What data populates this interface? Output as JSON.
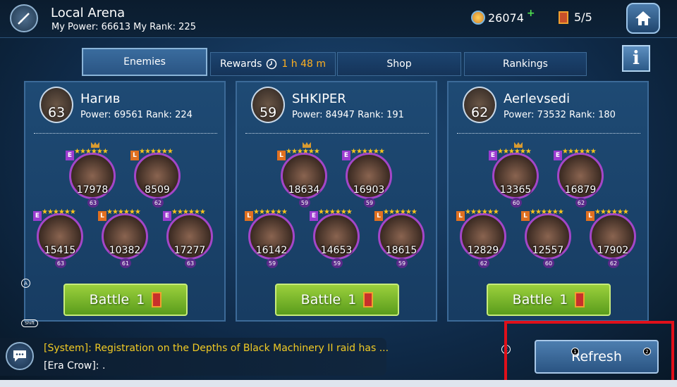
{
  "header": {
    "title": "Local Arena",
    "subtitle": "My Power: 66613 My Rank: 225",
    "coins": "26074",
    "coins_plus": "+",
    "tickets": "5/5"
  },
  "tabs": {
    "enemies": "Enemies",
    "rewards": "Rewards",
    "rewards_timer": "1 h 48 m",
    "shop": "Shop",
    "rankings": "Rankings",
    "info": "i"
  },
  "opponents": [
    {
      "name": "Нагив",
      "level": "63",
      "stats": "Power: 69561 Rank: 224",
      "battle_label": "Battle",
      "battle_cost": "1",
      "heroes": [
        {
          "power": "17978",
          "level": "63",
          "badge": "E"
        },
        {
          "power": "8509",
          "level": "62",
          "badge": "L"
        },
        {
          "power": "15415",
          "level": "63",
          "badge": "E"
        },
        {
          "power": "10382",
          "level": "61",
          "badge": "L"
        },
        {
          "power": "17277",
          "level": "63",
          "badge": "E"
        }
      ]
    },
    {
      "name": "SHKIPER",
      "level": "59",
      "stats": "Power: 84947 Rank: 191",
      "battle_label": "Battle",
      "battle_cost": "1",
      "heroes": [
        {
          "power": "18634",
          "level": "59",
          "badge": "L"
        },
        {
          "power": "16903",
          "level": "59",
          "badge": "E"
        },
        {
          "power": "16142",
          "level": "59",
          "badge": "L"
        },
        {
          "power": "14653",
          "level": "59",
          "badge": "E"
        },
        {
          "power": "18615",
          "level": "59",
          "badge": "L"
        }
      ]
    },
    {
      "name": "Aerlevsedi",
      "level": "62",
      "stats": "Power: 73532 Rank: 180",
      "battle_label": "Battle",
      "battle_cost": "1",
      "heroes": [
        {
          "power": "13365",
          "level": "60",
          "badge": "E"
        },
        {
          "power": "16879",
          "level": "62",
          "badge": "E"
        },
        {
          "power": "12829",
          "level": "62",
          "badge": "L"
        },
        {
          "power": "12557",
          "level": "60",
          "badge": "L"
        },
        {
          "power": "17902",
          "level": "62",
          "badge": "L"
        }
      ]
    }
  ],
  "hints": {
    "a": "A",
    "shift": "Shift",
    "c": "C",
    "one": "1",
    "two": "2"
  },
  "chat": {
    "line1": "[System]: Registration on the Depths of Black Machinery II raid has ...",
    "line2": "[Era Crow]: ."
  },
  "refresh_label": "Refresh",
  "colors": {
    "highlight": "#e0101a",
    "battle_green": "#7ab82c",
    "system_text": "#f2cb24",
    "timer": "#ffb020"
  }
}
